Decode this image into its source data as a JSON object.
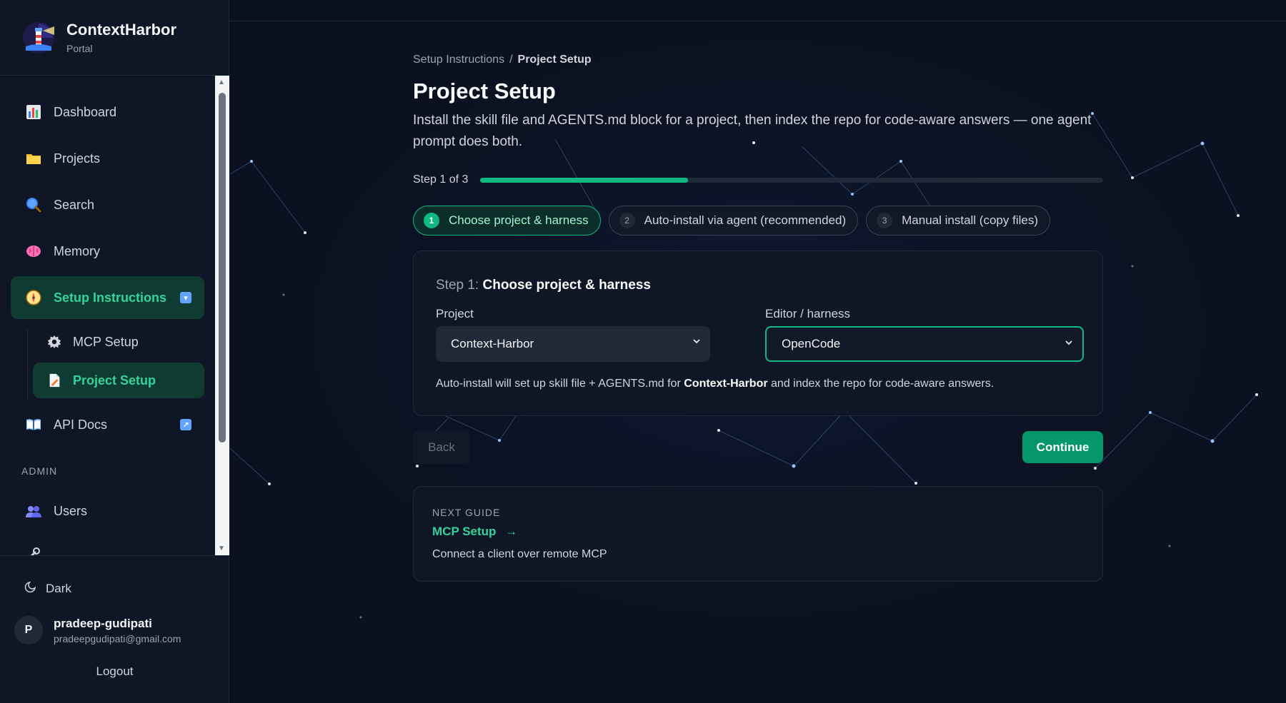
{
  "app": {
    "name": "ContextHarbor",
    "subtitle": "Portal"
  },
  "sidebar": {
    "items": [
      {
        "label": "Dashboard",
        "icon": "chart-icon"
      },
      {
        "label": "Projects",
        "icon": "folder-icon"
      },
      {
        "label": "Search",
        "icon": "search-icon"
      },
      {
        "label": "Memory",
        "icon": "brain-icon"
      },
      {
        "label": "Setup Instructions",
        "icon": "compass-icon",
        "active": true
      },
      {
        "label": "API Docs",
        "icon": "book-icon"
      }
    ],
    "subitems": [
      {
        "label": "MCP Setup",
        "icon": "gear-icon"
      },
      {
        "label": "Project Setup",
        "icon": "document-icon",
        "active": true
      }
    ],
    "admin_label": "ADMIN",
    "admin_items": [
      {
        "label": "Users",
        "icon": "users-icon"
      }
    ],
    "theme_label": "Dark",
    "user": {
      "initial": "P",
      "name": "pradeep-gudipati",
      "email": "pradeepgudipati@gmail.com"
    },
    "logout_label": "Logout"
  },
  "breadcrumb": {
    "parent": "Setup Instructions",
    "separator": "/",
    "current": "Project Setup"
  },
  "page": {
    "title": "Project Setup",
    "description": "Install the skill file and AGENTS.md block for a project, then index the repo for code-aware answers — one agent prompt does both."
  },
  "progress": {
    "label": "Step 1 of 3",
    "current": 1,
    "total": 3
  },
  "steps": [
    {
      "num": "1",
      "label": "Choose project & harness",
      "active": true
    },
    {
      "num": "2",
      "label": "Auto-install via agent (recommended)",
      "active": false
    },
    {
      "num": "3",
      "label": "Manual install (copy files)",
      "active": false
    }
  ],
  "card": {
    "step_prefix": "Step 1:",
    "step_title": "Choose project & harness",
    "project_label": "Project",
    "project_value": "Context-Harbor",
    "harness_label": "Editor / harness",
    "harness_value": "OpenCode",
    "note_before": "Auto-install will set up skill file + AGENTS.md for ",
    "note_project": "Context-Harbor",
    "note_after": " and index the repo for code-aware answers."
  },
  "buttons": {
    "back": "Back",
    "continue": "Continue"
  },
  "next_guide": {
    "eyebrow": "NEXT GUIDE",
    "link": "MCP Setup",
    "arrow": "→",
    "description": "Connect a client over remote MCP"
  },
  "colors": {
    "accent": "#10b981",
    "bg": "#0b1120",
    "panel": "#0f1625"
  }
}
